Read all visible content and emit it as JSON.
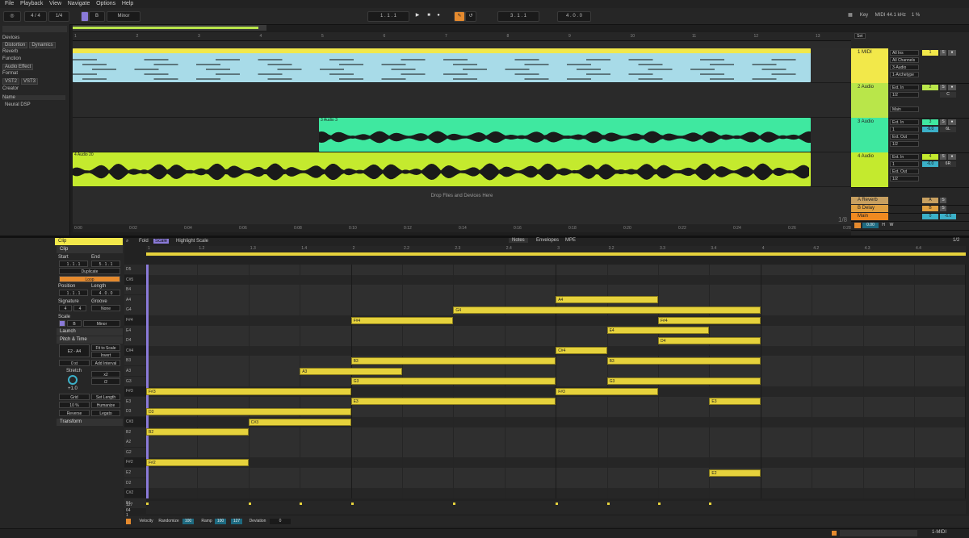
{
  "menu": [
    "File",
    "Playback",
    "View",
    "Navigate",
    "Options",
    "Help"
  ],
  "transport": {
    "signature": "4 / 4",
    "quantize": "1/4",
    "scale_root": "B",
    "scale_mode": "Minor",
    "position": "1 . 1 . 1",
    "loop_start": "3 . 1 . 1",
    "loop_length": "4 . 0 . 0",
    "key_label": "Key",
    "midi_label": "MIDI",
    "sample_rate": "44.1 kHz",
    "cpu": "1 %"
  },
  "browser": {
    "devices_label": "Devices",
    "device_chips": [
      "Distortion",
      "Dynamics"
    ],
    "reverb_label": "Reverb",
    "function_label": "Function",
    "audio_effect": "Audio Effect",
    "format_label": "Format",
    "format_chips": [
      "VST2",
      "VST3"
    ],
    "creator_label": "Creator",
    "name_header": "Name",
    "items": [
      "Neural DSP"
    ]
  },
  "arrangement": {
    "bar_numbers": [
      "1",
      "2",
      "3",
      "4",
      "5",
      "6",
      "7",
      "8",
      "9",
      "10",
      "11",
      "12",
      "13"
    ],
    "time_labels": [
      "0:00",
      "0:02",
      "0:04",
      "0:06",
      "0:08",
      "0:10",
      "0:12",
      "0:14",
      "0:16",
      "0:18",
      "0:20",
      "0:22",
      "0:24",
      "0:26",
      "0:28"
    ],
    "clips": {
      "midi": "",
      "audio3": "3 Audio 3",
      "audio4": "4 Audio 20"
    },
    "drop_text": "Drop Files and Devices Here",
    "zoom_label": "1/8"
  },
  "mixer": {
    "set_label": "Set",
    "tracks": [
      {
        "name": "1 MIDI",
        "number": "1",
        "input": "All Ins",
        "channel": "All Channels",
        "out": "3-Audio",
        "out2": "1-Archetype",
        "color": "#f2e84a"
      },
      {
        "name": "2 Audio",
        "number": "2",
        "input": "Ext. In",
        "channel": "1/2",
        "monitor_in": "In",
        "monitor_auto": "Auto",
        "monitor_off": "Off",
        "out": "Main",
        "pan": "C",
        "color": "#b9e64a"
      },
      {
        "name": "3 Audio",
        "number": "3",
        "input": "Ext. In",
        "channel": "1",
        "out": "Ext. Out",
        "out2": "1/2",
        "volume": "-6.0",
        "pan": "6L",
        "color": "#3fe8a0"
      },
      {
        "name": "4 Audio",
        "number": "4",
        "input": "Ext. In",
        "channel": "1",
        "out": "Ext. Out",
        "out2": "1/2",
        "volume": "-6.0",
        "pan": "6R",
        "color": "#c4ea2e"
      }
    ],
    "returns": [
      {
        "name": "A Reverb",
        "letter": "A",
        "color": "#c8a060"
      },
      {
        "name": "B Delay",
        "letter": "B",
        "color": "#e0a040"
      }
    ],
    "main": {
      "name": "Main",
      "letter": "M",
      "volume": "0",
      "value": "-6.0",
      "color": "#f08a20"
    },
    "bottom": {
      "tempo": "0.00",
      "h": "H",
      "w": "W"
    }
  },
  "clip_view": {
    "header": "Clip",
    "clip_section": "Clip",
    "start_label": "Start",
    "end_label": "End",
    "set_label": "Set",
    "start_value": [
      "1",
      "1",
      "1"
    ],
    "end_value": [
      "5",
      "1",
      "1"
    ],
    "duplicate": "Duplicate",
    "loop": "Loop",
    "position_label": "Position",
    "length_label": "Length",
    "position_value": [
      "1",
      "1",
      "1"
    ],
    "length_value": [
      "4",
      "0",
      "0"
    ],
    "signature_label": "Signature",
    "groove_label": "Groove",
    "sig_num": "4",
    "sig_den": "4",
    "groove_value": "None",
    "scale_label": "Scale",
    "scale_root": "B",
    "scale_mode": "Minor",
    "launch": "Launch",
    "pitch_time": "Pitch & Time",
    "range": "E2 - A4",
    "fit_to_scale": "Fit to Scale",
    "invert": "Invert",
    "transpose": "0 st",
    "add_interval": "Add Interval",
    "stretch": "Stretch",
    "stretch_x2": "x2",
    "stretch_d2": "/2",
    "stretch_val": "+1.0",
    "grid": "Grid",
    "set_length": "Set Length",
    "percent": "10 %",
    "humanize": "Humanize",
    "reverse": "Reverse",
    "legato": "Legato",
    "transform": "Transform"
  },
  "editor": {
    "fold": "Fold",
    "scale": "Scale",
    "highlight": "Highlight Scale",
    "tabs": [
      "Notes",
      "Envelopes",
      "MPE"
    ],
    "grid_quant": "1/2",
    "ruler": [
      "1",
      "1.2",
      "1.3",
      "1.4",
      "2",
      "2.2",
      "2.3",
      "2.4",
      "3",
      "3.2",
      "3.3",
      "3.4",
      "4",
      "4.2",
      "4.3",
      "4.4"
    ],
    "keys": [
      "D5",
      "C#5",
      "B4",
      "A4",
      "G4",
      "F#4",
      "E4",
      "D4",
      "C#4",
      "B3",
      "A3",
      "G3",
      "F#3",
      "E3",
      "D3",
      "C#3",
      "B2",
      "A2",
      "G2",
      "F#2",
      "E2",
      "D2",
      "C#2",
      "B1"
    ],
    "notes": [
      {
        "label": "A4",
        "key": 3,
        "start": 2.0,
        "len": 1.0
      },
      {
        "label": "G4",
        "key": 4,
        "start": 1.0,
        "len": 3.0
      },
      {
        "label": "F#4",
        "key": 5,
        "start": 0.0,
        "len": 1.0
      },
      {
        "label": "F#4",
        "key": 5,
        "start": 3.0,
        "len": 1.0
      },
      {
        "label": "E4",
        "key": 6,
        "start": 2.5,
        "len": 1.0
      },
      {
        "label": "D4",
        "key": 7,
        "start": 3.0,
        "len": 1.0
      },
      {
        "label": "C#4",
        "key": 8,
        "start": 2.0,
        "len": 0.5
      },
      {
        "label": "B3",
        "key": 9,
        "start": 0.0,
        "len": 2.0
      },
      {
        "label": "B3",
        "key": 9,
        "start": 2.5,
        "len": 1.5
      },
      {
        "label": "A3",
        "key": 10,
        "start": -0.5,
        "len": 1.0
      },
      {
        "label": "G3",
        "key": 11,
        "start": 0.0,
        "len": 2.0
      },
      {
        "label": "G3",
        "key": 11,
        "start": 2.5,
        "len": 1.5
      },
      {
        "label": "F#3",
        "key": 12,
        "start": -2.0,
        "len": 2.0
      },
      {
        "label": "F#3",
        "key": 12,
        "start": 2.0,
        "len": 1.0
      },
      {
        "label": "E3",
        "key": 13,
        "start": 0.0,
        "len": 2.0
      },
      {
        "label": "E3",
        "key": 13,
        "start": 3.5,
        "len": 0.5
      },
      {
        "label": "D3",
        "key": 14,
        "start": -2.0,
        "len": 2.0
      },
      {
        "label": "C#3",
        "key": 15,
        "start": -1.0,
        "len": 1.0
      },
      {
        "label": "B2",
        "key": 16,
        "start": -2.0,
        "len": 1.0
      },
      {
        "label": "F#2",
        "key": 19,
        "start": -2.0,
        "len": 1.0
      },
      {
        "label": "E2",
        "key": 20,
        "start": 3.5,
        "len": 0.5
      }
    ],
    "vel_top": "127",
    "vel_mid": "64",
    "vel_bot": "1",
    "velocity_label": "Velocity",
    "randomize": "Randomize",
    "rand_val": "100",
    "ramp": "Ramp",
    "ramp_a": "100",
    "ramp_b": "127",
    "deviation": "Deviation",
    "dev_val": "0"
  },
  "status": {
    "track": "1-MIDI"
  }
}
